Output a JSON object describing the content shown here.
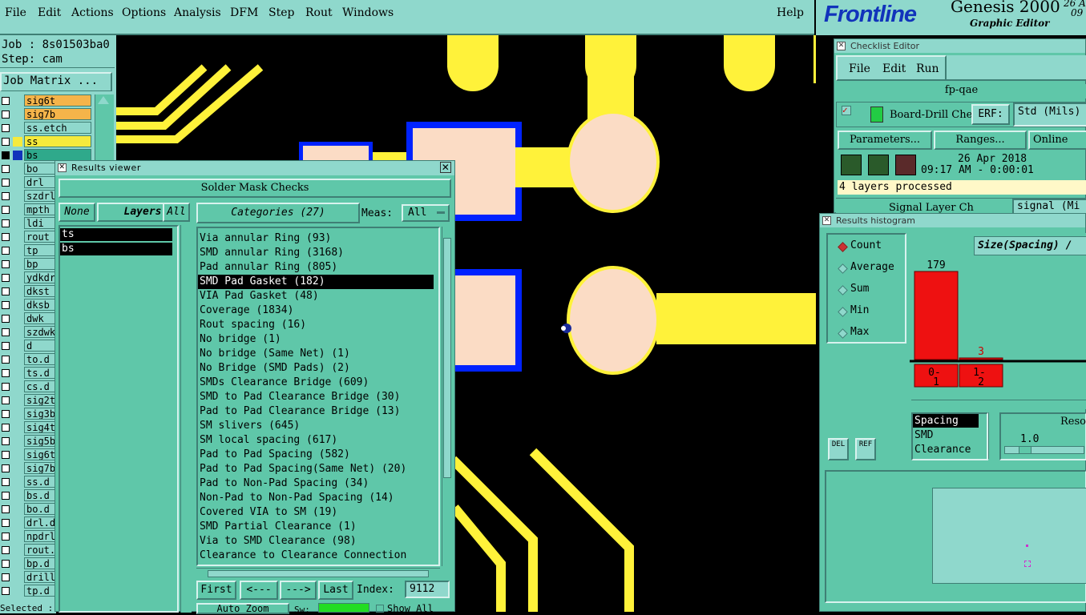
{
  "menubar": {
    "items": [
      "File",
      "Edit",
      "Actions",
      "Options",
      "Analysis",
      "DFM",
      "Step",
      "Rout",
      "Windows"
    ],
    "help": "Help"
  },
  "brand": {
    "logo": "Frontline",
    "product": "Genesis 2000",
    "subtitle": "Graphic Editor",
    "date_fragment": "26 A",
    "time_fragment": "09"
  },
  "job_panel": {
    "job": "Job : 8s01503ba0",
    "step": "Step: cam",
    "job_matrix_button": "Job Matrix ...",
    "selected_label": "Selected :",
    "layers": [
      {
        "name": "sig6t",
        "color": "#f5b44a"
      },
      {
        "name": "sig7b",
        "color": "#f5b44a"
      },
      {
        "name": "ss.etch",
        "color": "#8fd8cc"
      },
      {
        "name": "ss",
        "color": "#f5ea3c"
      },
      {
        "name": "bs",
        "color": "#2fa98b"
      },
      {
        "name": "bo",
        "color": "#8fd8cc"
      },
      {
        "name": "drl",
        "color": "#8fd8cc"
      },
      {
        "name": "szdrl",
        "color": "#8fd8cc"
      },
      {
        "name": "mpth",
        "color": "#8fd8cc"
      },
      {
        "name": "ldi",
        "color": "#8fd8cc"
      },
      {
        "name": "rout",
        "color": "#8fd8cc"
      },
      {
        "name": "tp",
        "color": "#8fd8cc"
      },
      {
        "name": "bp",
        "color": "#8fd8cc"
      },
      {
        "name": "ydkdr",
        "color": "#8fd8cc"
      },
      {
        "name": "dkst",
        "color": "#8fd8cc"
      },
      {
        "name": "dksb",
        "color": "#8fd8cc"
      },
      {
        "name": "dwk",
        "color": "#8fd8cc"
      },
      {
        "name": "szdwk",
        "color": "#8fd8cc"
      },
      {
        "name": "d",
        "color": "#8fd8cc"
      },
      {
        "name": "to.d",
        "color": "#8fd8cc"
      },
      {
        "name": "ts.d",
        "color": "#8fd8cc"
      },
      {
        "name": "cs.d",
        "color": "#8fd8cc"
      },
      {
        "name": "sig2t",
        "color": "#8fd8cc"
      },
      {
        "name": "sig3b",
        "color": "#8fd8cc"
      },
      {
        "name": "sig4t",
        "color": "#8fd8cc"
      },
      {
        "name": "sig5b",
        "color": "#8fd8cc"
      },
      {
        "name": "sig6t",
        "color": "#8fd8cc"
      },
      {
        "name": "sig7b",
        "color": "#8fd8cc"
      },
      {
        "name": "ss.d",
        "color": "#8fd8cc"
      },
      {
        "name": "bs.d",
        "color": "#8fd8cc"
      },
      {
        "name": "bo.d",
        "color": "#8fd8cc"
      },
      {
        "name": "drl.d",
        "color": "#8fd8cc"
      },
      {
        "name": "npdrl",
        "color": "#8fd8cc"
      },
      {
        "name": "rout.",
        "color": "#8fd8cc"
      },
      {
        "name": "bp.d",
        "color": "#8fd8cc"
      },
      {
        "name": "drill",
        "color": "#8fd8cc"
      },
      {
        "name": "tp.d",
        "color": "#8fd8cc"
      }
    ]
  },
  "results_viewer": {
    "title": "Results viewer",
    "header": "Solder Mask Checks",
    "none_btn": "None",
    "layers_btn": "Layers",
    "all_btn": "All",
    "categories_btn": "Categories (27)",
    "meas_label": "Meas:",
    "meas_value": "All",
    "layers": [
      "ts",
      "bs"
    ],
    "categories": [
      "Via annular Ring (93)",
      "SMD annular Ring (3168)",
      "Pad annular Ring (805)",
      "SMD Pad Gasket (182)",
      "VIA Pad Gasket (48)",
      "Coverage (1834)",
      "Rout spacing (16)",
      "No bridge (1)",
      "No bridge (Same Net) (1)",
      "No Bridge (SMD Pads) (2)",
      "SMDs Clearance Bridge (609)",
      "SMD to Pad Clearance Bridge (30)",
      "Pad to Pad Clearance Bridge (13)",
      "SM slivers (645)",
      "SM local spacing (617)",
      "Pad to Pad Spacing (582)",
      "Pad to Pad Spacing(Same Net) (20)",
      "Pad to Non-Pad Spacing (34)",
      "Non-Pad to Non-Pad Spacing (14)",
      "Covered VIA to SM (19)",
      "SMD Partial Clearance (1)",
      "Via to SMD Clearance (98)",
      "Clearance to Clearance Connection"
    ],
    "selected_category": 3,
    "first_btn": "First",
    "prev_btn": "<---",
    "next_btn": "--->",
    "last_btn": "Last",
    "index_label": "Index:",
    "index_value": "9112",
    "auto_zoom": "Auto Zoom",
    "sw_label": "Sw:",
    "show_all": "Show All"
  },
  "checklist_editor": {
    "title": "Checklist Editor",
    "menu": [
      "File",
      "Edit",
      "Run"
    ],
    "checklist_name": "fp-qae",
    "check1_name": "Board-Drill Che",
    "erf_label": "ERF:",
    "erf_value": "Std (Mils)",
    "parameters_btn": "Parameters...",
    "ranges_btn": "Ranges...",
    "online_btn": "Online",
    "date": "26 Apr 2018",
    "time": "09:17 AM - 0:00:01",
    "status": "4 layers processed",
    "check2_name": "Signal Layer Ch",
    "erf2_value": "signal (Mi"
  },
  "results_histogram": {
    "title": "Results histogram",
    "modes": [
      "Count",
      "Average",
      "Sum",
      "Min",
      "Max"
    ],
    "active_mode": 0,
    "chart_title": "Size(Spacing) /",
    "bins": [
      {
        "label_top": "0-",
        "label_bottom": "1",
        "count": 179
      },
      {
        "label_top": "1-",
        "label_bottom": "2",
        "count": 3
      }
    ],
    "del_btn": "DEL",
    "ref_btn": "REF",
    "list": [
      "Spacing",
      "SMD",
      "Clearance"
    ],
    "reso_label": "Reso",
    "reso_value": "1.0"
  },
  "colors": {
    "panel": "#8fd8cc",
    "panel_dark": "#5fc7a9",
    "trace": "#fff23a",
    "pad": "#fbdcc5",
    "mask": "#0022ff",
    "bar": "#ee1111"
  }
}
